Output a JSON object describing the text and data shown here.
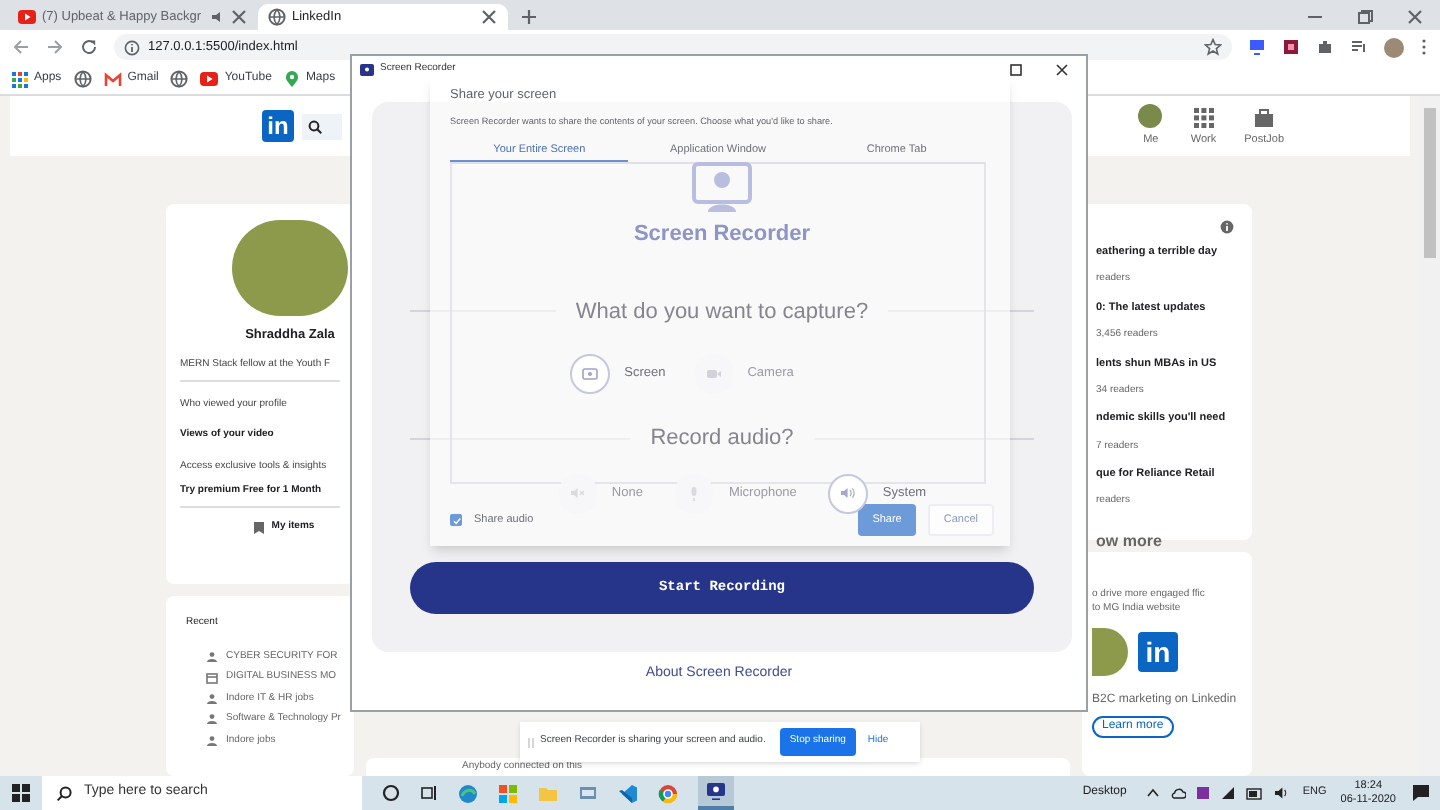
{
  "browser": {
    "tabs": [
      {
        "label": "(7) Upbeat & Happy Backgr",
        "selected": false
      },
      {
        "label": "LinkedIn",
        "selected": true
      }
    ],
    "url": "127.0.0.1:5500/index.html",
    "bookmarks": [
      "Apps",
      "Gmail",
      "YouTube",
      "Maps"
    ]
  },
  "linkedin": {
    "logo": "in",
    "nav": [
      "Me",
      "Work",
      "PostJob"
    ],
    "profile": {
      "name": "Shraddha Zala",
      "headline": "MERN Stack fellow at the Youth F",
      "links": [
        "Who viewed your profile",
        "Views of your video"
      ],
      "premium_prompt": "Access exclusive tools & insights",
      "premium_link": "Try premium Free for 1 Month",
      "my_items": "My items"
    },
    "recent": {
      "title": "Recent",
      "items": [
        {
          "label": "CYBER SECURITY FOR",
          "kind": "group"
        },
        {
          "label": "DIGITAL BUSINESS MO",
          "kind": "event"
        },
        {
          "label": "Indore IT & HR jobs",
          "kind": "group"
        },
        {
          "label": "Software & Technology Pr",
          "kind": "group"
        },
        {
          "label": "Indore jobs",
          "kind": "group"
        }
      ]
    },
    "news": [
      {
        "headline": "eathering a terrible day",
        "readers": "readers"
      },
      {
        "headline": "0: The latest updates",
        "readers": "3,456 readers"
      },
      {
        "headline": "lents shun MBAs in US",
        "readers": "34 readers"
      },
      {
        "headline": "ndemic skills you'll need",
        "readers": "7 readers"
      },
      {
        "headline": "que for Reliance Retail",
        "readers": "readers"
      }
    ],
    "show_more": "ow more",
    "ad": {
      "text": "o drive more engaged ffic to MG India website",
      "logo": "in",
      "caption": "B2C marketing on Linkedin",
      "button": "Learn more"
    },
    "feed_text": "Anybody connected on this"
  },
  "recorder_window": {
    "title": "Screen Recorder",
    "heading": "Screen Recorder",
    "capture_question": "What do you want to capture?",
    "capture_options": [
      {
        "label": "Screen",
        "selected": true
      },
      {
        "label": "Camera",
        "selected": false
      }
    ],
    "audio_question": "Record audio?",
    "audio_options": [
      {
        "label": "None",
        "selected": false
      },
      {
        "label": "Microphone",
        "selected": false
      },
      {
        "label": "System",
        "selected": true
      }
    ],
    "start_button": "Start Recording",
    "about_link": "About Screen Recorder"
  },
  "share_dialog": {
    "title": "Share your screen",
    "description": "Screen Recorder wants to share the contents of your screen. Choose what you'd like to share.",
    "tabs": [
      {
        "label": "Your Entire Screen",
        "selected": true
      },
      {
        "label": "Application Window",
        "selected": false
      },
      {
        "label": "Chrome Tab",
        "selected": false
      }
    ],
    "share_audio": {
      "label": "Share audio",
      "checked": true
    },
    "buttons": [
      "Share",
      "Cancel"
    ]
  },
  "sharing_bar": {
    "message": "Screen Recorder is sharing your screen and audio.",
    "stop_button": "Stop sharing",
    "hide_button": "Hide"
  },
  "taskbar": {
    "search_placeholder": "Type here to search",
    "desktop_label": "Desktop",
    "language": "ENG",
    "time": "18:24",
    "date": "06-11-2020"
  }
}
